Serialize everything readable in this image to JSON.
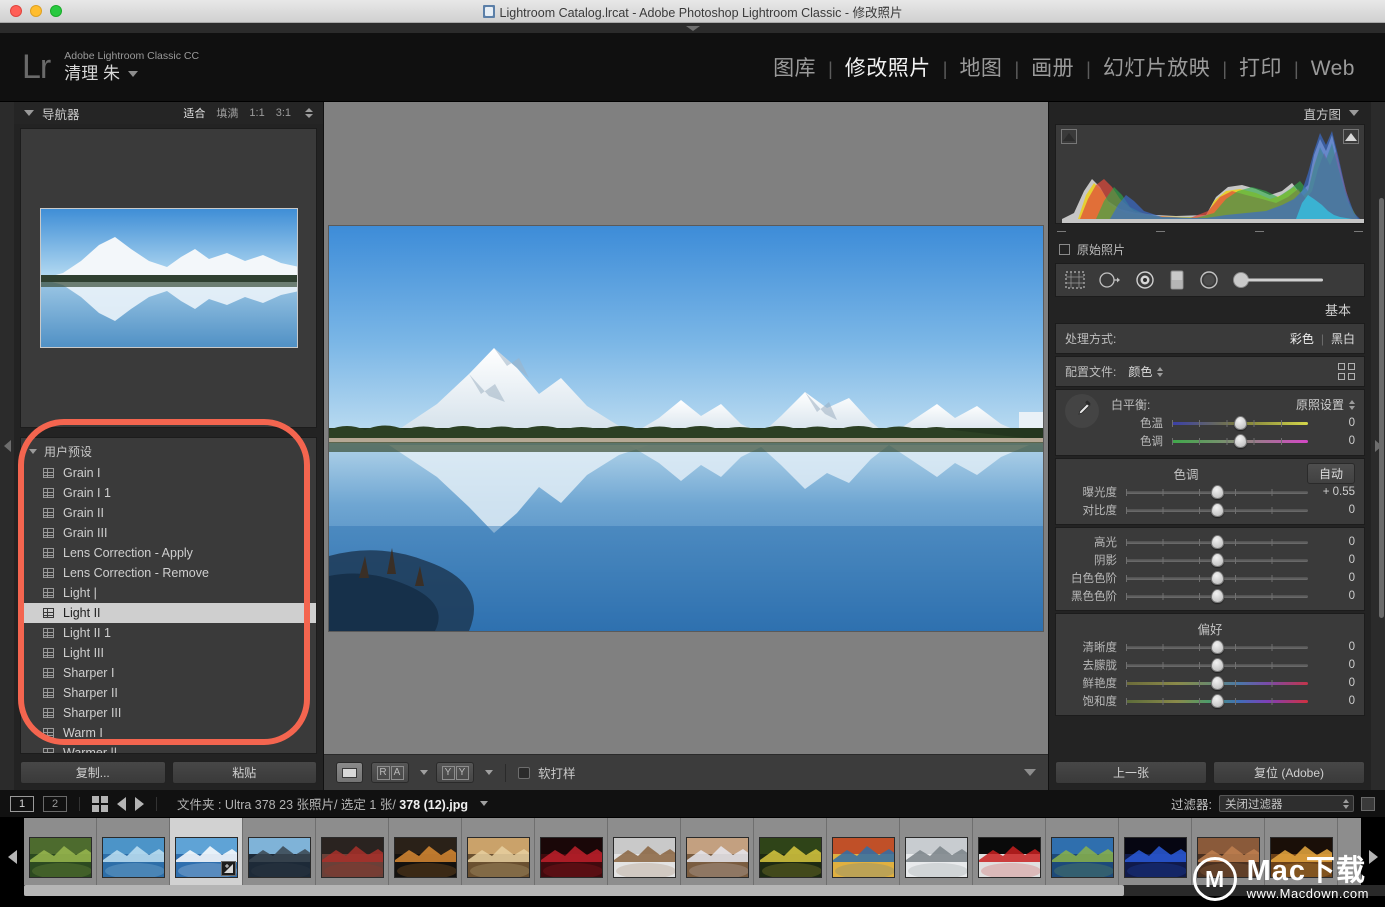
{
  "window": {
    "title": "Lightroom Catalog.lrcat - Adobe Photoshop Lightroom Classic - 修改照片",
    "icon": "catalog-icon"
  },
  "identity": {
    "logo": "Lr",
    "app_name": "Adobe Lightroom Classic CC",
    "user_name": "清理 朱"
  },
  "modules": [
    {
      "label": "图库",
      "active": false
    },
    {
      "label": "修改照片",
      "active": true
    },
    {
      "label": "地图",
      "active": false
    },
    {
      "label": "画册",
      "active": false
    },
    {
      "label": "幻灯片放映",
      "active": false
    },
    {
      "label": "打印",
      "active": false
    },
    {
      "label": "Web",
      "active": false
    }
  ],
  "module_separator": "|",
  "navigator": {
    "title": "导航器",
    "modes": [
      {
        "label": "适合",
        "active": true
      },
      {
        "label": "填满",
        "active": false
      },
      {
        "label": "1:1",
        "active": false
      },
      {
        "label": "3:1",
        "active": false
      }
    ]
  },
  "presets": {
    "group_title": "用户预设",
    "items": [
      {
        "label": "Grain I",
        "selected": false
      },
      {
        "label": "Grain I 1",
        "selected": false
      },
      {
        "label": "Grain II",
        "selected": false
      },
      {
        "label": "Grain III",
        "selected": false
      },
      {
        "label": "Lens Correction - Apply",
        "selected": false
      },
      {
        "label": "Lens Correction - Remove",
        "selected": false
      },
      {
        "label": "Light |",
        "selected": false
      },
      {
        "label": "Light II",
        "selected": true
      },
      {
        "label": "Light II 1",
        "selected": false
      },
      {
        "label": "Light III",
        "selected": false
      },
      {
        "label": "Sharper I",
        "selected": false
      },
      {
        "label": "Sharper II",
        "selected": false
      },
      {
        "label": "Sharper III",
        "selected": false
      },
      {
        "label": "Warm I",
        "selected": false
      },
      {
        "label": "Warmer ||",
        "selected": false
      }
    ],
    "highlight_color": "#f4654f"
  },
  "left_footer": {
    "copy_label": "复制...",
    "paste_label": "粘贴"
  },
  "toolbar": {
    "view_single": "single-view",
    "view_ra": [
      "R",
      "A"
    ],
    "view_yy": [
      "Y",
      "Y"
    ],
    "soft_proof_label": "软打样",
    "soft_proof_checked": false
  },
  "histogram": {
    "title": "直方图",
    "original_label": "原始照片",
    "original_checked": false,
    "clipping_shadow": "shadow-clip-indicator",
    "clipping_highlight": "highlight-clip-indicator"
  },
  "tools": [
    "crop-overlay-icon",
    "spot-removal-icon",
    "red-eye-icon",
    "graduated-filter-icon",
    "radial-filter-icon",
    "adjustment-brush-icon"
  ],
  "basic": {
    "title": "基本",
    "treatment": {
      "label": "处理方式:",
      "color": "彩色",
      "bw": "黑白",
      "active": "彩色"
    },
    "profile": {
      "label": "配置文件:",
      "value": "颜色"
    },
    "white_balance": {
      "label": "白平衡:",
      "value": "原照设置",
      "sliders": [
        {
          "label": "色温",
          "value": "0",
          "pos": 50,
          "grad": "grad-temp"
        },
        {
          "label": "色调",
          "value": "0",
          "pos": 50,
          "grad": "grad-tint"
        }
      ]
    },
    "tone": {
      "title": "色调",
      "auto_label": "自动",
      "sliders": [
        {
          "label": "曝光度",
          "value": "+ 0.55",
          "pos": 50,
          "grad": ""
        },
        {
          "label": "对比度",
          "value": "0",
          "pos": 50,
          "grad": ""
        }
      ],
      "sliders2": [
        {
          "label": "高光",
          "value": "0",
          "pos": 50,
          "grad": ""
        },
        {
          "label": "阴影",
          "value": "0",
          "pos": 50,
          "grad": ""
        },
        {
          "label": "白色色阶",
          "value": "0",
          "pos": 50,
          "grad": ""
        },
        {
          "label": "黑色色阶",
          "value": "0",
          "pos": 50,
          "grad": ""
        }
      ]
    },
    "presence": {
      "title": "偏好",
      "sliders": [
        {
          "label": "清晰度",
          "value": "0",
          "pos": 50,
          "grad": ""
        },
        {
          "label": "去朦胧",
          "value": "0",
          "pos": 50,
          "grad": ""
        },
        {
          "label": "鲜艳度",
          "value": "0",
          "pos": 50,
          "grad": "grad-vib"
        },
        {
          "label": "饱和度",
          "value": "0",
          "pos": 50,
          "grad": "grad-sat"
        }
      ]
    }
  },
  "right_footer": {
    "previous_label": "上一张",
    "reset_label": "复位 (Adobe)"
  },
  "filmstrip": {
    "page1": "1",
    "page2": "2",
    "grid_icon": "grid-view-icon",
    "back_icon": "back-arrow-icon",
    "forward_icon": "forward-arrow-icon",
    "info_prefix": "文件夹 : Ultra 378   23 张照片/ 选定 1 张/ ",
    "info_file": "378 (12).jpg",
    "filter_label": "过滤器:",
    "filter_value": "关闭过滤器",
    "thumbnails": [
      {
        "name": "thumb-green-valley",
        "selected": false,
        "badge": false
      },
      {
        "name": "thumb-blue-lake",
        "selected": false,
        "badge": false
      },
      {
        "name": "thumb-teton-reflection",
        "selected": true,
        "badge": true
      },
      {
        "name": "thumb-seaplane",
        "selected": false,
        "badge": false
      },
      {
        "name": "thumb-red-car",
        "selected": false,
        "badge": false
      },
      {
        "name": "thumb-sunset-volcano",
        "selected": false,
        "badge": false
      },
      {
        "name": "thumb-leopard",
        "selected": false,
        "badge": false
      },
      {
        "name": "thumb-red-dark",
        "selected": false,
        "badge": false
      },
      {
        "name": "thumb-coffee-head",
        "selected": false,
        "badge": false
      },
      {
        "name": "thumb-wood-flowers",
        "selected": false,
        "badge": false
      },
      {
        "name": "thumb-waterfall-flowers",
        "selected": false,
        "badge": false
      },
      {
        "name": "thumb-food-table",
        "selected": false,
        "badge": false
      },
      {
        "name": "thumb-concept-car",
        "selected": false,
        "badge": false
      },
      {
        "name": "thumb-red-ribbon",
        "selected": false,
        "badge": false
      },
      {
        "name": "thumb-aerial-coast",
        "selected": false,
        "badge": false
      },
      {
        "name": "thumb-blue-orb",
        "selected": false,
        "badge": false
      },
      {
        "name": "thumb-canyon-road",
        "selected": false,
        "badge": false
      },
      {
        "name": "thumb-candles",
        "selected": false,
        "badge": false
      }
    ]
  },
  "watermark": {
    "mark": "M",
    "line1": "Mac下载",
    "line2": "www.Macdown.com"
  },
  "colors": {
    "panel_bg": "#232323",
    "block_bg": "#3a3a3a",
    "canvas_bg": "#808080",
    "accent_red": "#f4654f"
  }
}
